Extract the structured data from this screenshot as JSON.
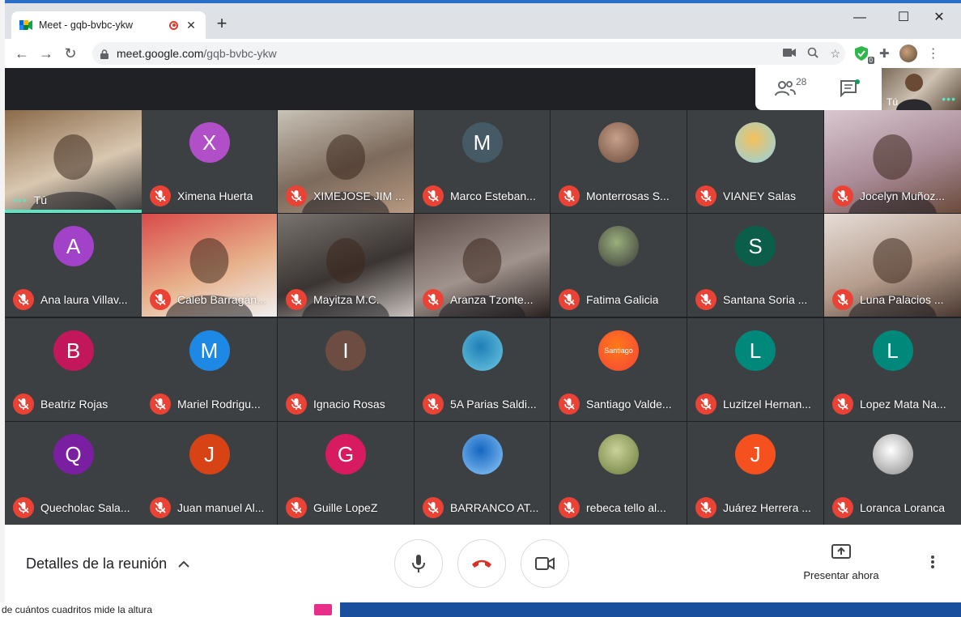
{
  "browser": {
    "tab_title": "Meet - gqb-bvbc-ykw",
    "new_tab": "+",
    "url_host": "meet.google.com",
    "url_path": "/gqb-bvbc-ykw",
    "ext_badge": "0"
  },
  "meet": {
    "people_count": "28",
    "self_label": "Tú",
    "details_label": "Detalles de la reunión",
    "present_label": "Presentar ahora",
    "participants": [
      {
        "name": "Tú",
        "type": "video",
        "self": true,
        "palette": [
          "#8a6a4a",
          "#d9c7b0",
          "#3a3a3a"
        ]
      },
      {
        "name": "Ximena Huerta",
        "type": "letter",
        "letter": "X",
        "color": "#b14fc8"
      },
      {
        "name": "XIMEJOSE JIM ...",
        "type": "video",
        "palette": [
          "#c9c2b6",
          "#7c6a5c",
          "#b89a82"
        ]
      },
      {
        "name": "Marco Esteban...",
        "type": "letter",
        "letter": "M",
        "color": "#455a64"
      },
      {
        "name": "Monterrosas S...",
        "type": "photo",
        "palette": [
          "#c7a08a",
          "#6b4b3b"
        ]
      },
      {
        "name": "VIANEY Salas",
        "type": "photo",
        "palette": [
          "#f6c15a",
          "#8fd3e8"
        ]
      },
      {
        "name": "Jocelyn Muñoz...",
        "type": "video",
        "palette": [
          "#d9c7cf",
          "#a88a96",
          "#6a4a3a"
        ]
      },
      {
        "name": "Ana laura Villav...",
        "type": "letter",
        "letter": "A",
        "color": "#a142c9"
      },
      {
        "name": "Caleb Barragán...",
        "type": "video",
        "palette": [
          "#d94a4a",
          "#e7b08a",
          "#f0f0f0"
        ]
      },
      {
        "name": "Mayitza M.C.",
        "type": "video",
        "palette": [
          "#7a7470",
          "#3a3432",
          "#c9c2be"
        ]
      },
      {
        "name": "Aranza Tzonte...",
        "type": "video",
        "palette": [
          "#5a4a46",
          "#a0928c",
          "#2a2220"
        ]
      },
      {
        "name": "Fatima Galicia",
        "type": "photo",
        "palette": [
          "#9ab07a",
          "#3a3a3a"
        ]
      },
      {
        "name": "Santana Soria ...",
        "type": "letter",
        "letter": "S",
        "color": "#0b5e4a"
      },
      {
        "name": "Luna Palacios ...",
        "type": "video",
        "palette": [
          "#e6ddd7",
          "#b59c8c",
          "#4a3a32"
        ]
      },
      {
        "name": "Beatriz Rojas",
        "type": "letter",
        "letter": "B",
        "color": "#c2185b"
      },
      {
        "name": "Mariel Rodrigu...",
        "type": "letter",
        "letter": "M",
        "color": "#1e88e5"
      },
      {
        "name": "Ignacio Rosas",
        "type": "letter",
        "letter": "I",
        "color": "#6d4c41"
      },
      {
        "name": "5A Parias Saldi...",
        "type": "photo",
        "palette": [
          "#1e7fb8",
          "#6ec9e0"
        ]
      },
      {
        "name": "Santiago Valde...",
        "type": "photo",
        "palette": [
          "#ff7a1a",
          "#f44336"
        ],
        "badge": "Santiago"
      },
      {
        "name": "Luzitzel Hernan...",
        "type": "letter",
        "letter": "L",
        "color": "#00897b"
      },
      {
        "name": "Lopez Mata Na...",
        "type": "letter",
        "letter": "L",
        "color": "#00897b"
      },
      {
        "name": "Quecholac Sala...",
        "type": "letter",
        "letter": "Q",
        "color": "#7b1fa2"
      },
      {
        "name": "Juan manuel Al...",
        "type": "letter",
        "letter": "J",
        "color": "#d84315"
      },
      {
        "name": "Guille LopeZ",
        "type": "letter",
        "letter": "G",
        "color": "#d81b60"
      },
      {
        "name": "BARRANCO AT...",
        "type": "photo",
        "palette": [
          "#1565c0",
          "#90caf9"
        ]
      },
      {
        "name": "rebeca tello al...",
        "type": "photo",
        "palette": [
          "#c9d29a",
          "#6b7a3a"
        ]
      },
      {
        "name": "Juárez Herrera ...",
        "type": "letter",
        "letter": "J",
        "color": "#f4511e"
      },
      {
        "name": "Loranca Loranca",
        "type": "photo",
        "palette": [
          "#ffffff",
          "#8a8a8a"
        ]
      }
    ]
  },
  "background_doc": {
    "text": "de cuántos cuadritos mide la altura"
  }
}
